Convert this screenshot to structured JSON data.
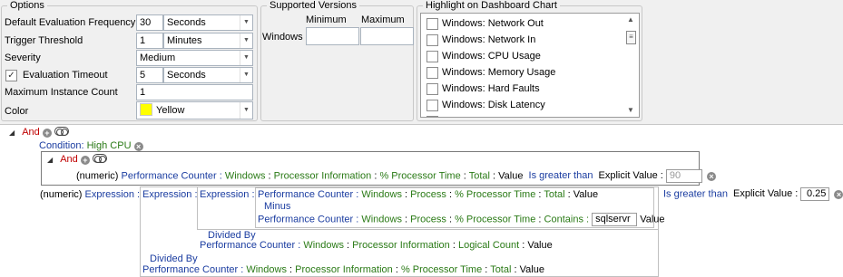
{
  "options": {
    "legend": "Options",
    "rows": {
      "frequency": {
        "label": "Default Evaluation Frequency",
        "value": "30",
        "unit": "Seconds"
      },
      "threshold": {
        "label": "Trigger Threshold",
        "value": "1",
        "unit": "Minutes"
      },
      "severity": {
        "label": "Severity",
        "value": "Medium"
      },
      "timeout": {
        "label": "Evaluation Timeout",
        "value": "5",
        "unit": "Seconds",
        "checked": true
      },
      "max_instance": {
        "label": "Maximum Instance Count",
        "value": "1"
      },
      "color": {
        "label": "Color",
        "value": "Yellow",
        "swatch": "#ffff00"
      }
    }
  },
  "versions": {
    "legend": "Supported Versions",
    "col_min": "Minimum",
    "col_max": "Maximum",
    "row_label": "Windows",
    "min_value": "",
    "max_value": ""
  },
  "highlight": {
    "legend": "Highlight on Dashboard Chart",
    "items": [
      "Windows: Network Out",
      "Windows: Network In",
      "Windows: CPU Usage",
      "Windows: Memory Usage",
      "Windows: Hard Faults",
      "Windows: Disk Latency"
    ]
  },
  "tree": {
    "and_label": "And",
    "condition_prefix": "Condition:",
    "condition_name": "High CPU",
    "numeric": "(numeric)",
    "perf_counter": "Performance Counter :",
    "colon": ":",
    "value_word": "Value",
    "windows": "Windows",
    "proc_info": "Processor Information",
    "pct_proc_time": "% Processor Time",
    "total": "Total",
    "is_greater_than": "Is greater than",
    "explicit_value": "Explicit Value :",
    "inner_threshold": "90",
    "outer_threshold": "0.25",
    "expression": "Expression :",
    "process": "Process",
    "minus": "Minus",
    "contains": "Contains :",
    "contains_value": "sqlservr",
    "divided_by": "Divided By",
    "logical_count": "Logical Count"
  }
}
